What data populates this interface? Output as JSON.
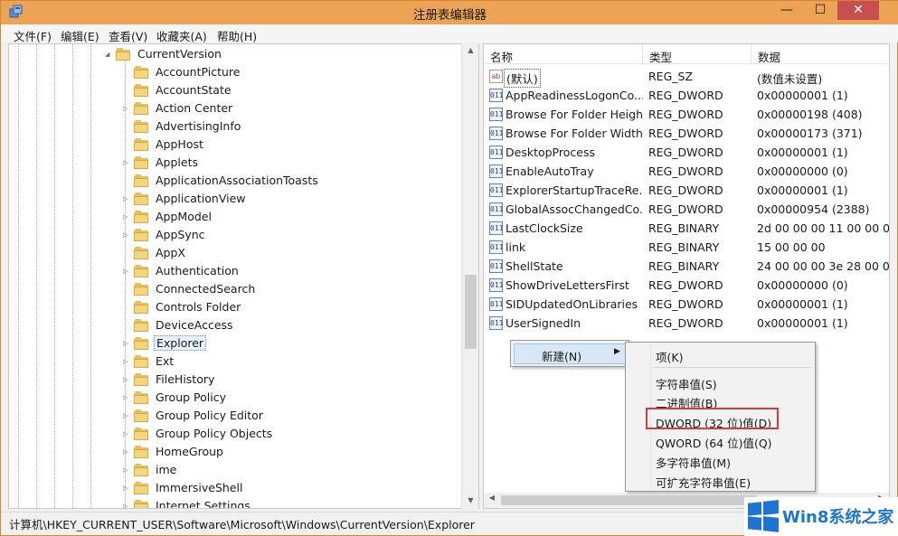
{
  "window": {
    "title": "注册表编辑器",
    "controls": {
      "minimize": "—",
      "maximize": "☐",
      "close": "✕"
    }
  },
  "menubar": [
    "文件(F)",
    "编辑(E)",
    "查看(V)",
    "收藏夹(A)",
    "帮助(H)"
  ],
  "tree": {
    "parent": "CurrentVersion",
    "items": [
      "AccountPicture",
      "AccountState",
      "Action Center",
      "AdvertisingInfo",
      "AppHost",
      "Applets",
      "ApplicationAssociationToasts",
      "ApplicationView",
      "AppModel",
      "AppSync",
      "AppX",
      "Authentication",
      "ConnectedSearch",
      "Controls Folder",
      "DeviceAccess",
      "Explorer",
      "Ext",
      "FileHistory",
      "Group Policy",
      "Group Policy Editor",
      "Group Policy Objects",
      "HomeGroup",
      "ime",
      "ImmersiveShell",
      "Internet Settings"
    ],
    "selected": "Explorer"
  },
  "list": {
    "columns": [
      "名称",
      "类型",
      "数据"
    ],
    "rows": [
      {
        "name": "(默认)",
        "type": "REG_SZ",
        "data": "(数值未设置)",
        "icon": "ab"
      },
      {
        "name": "AppReadinessLogonCo...",
        "type": "REG_DWORD",
        "data": "0x00000001 (1)",
        "icon": "011"
      },
      {
        "name": "Browse For Folder Height",
        "type": "REG_DWORD",
        "data": "0x00000198 (408)",
        "icon": "011"
      },
      {
        "name": "Browse For Folder Width",
        "type": "REG_DWORD",
        "data": "0x00000173 (371)",
        "icon": "011"
      },
      {
        "name": "DesktopProcess",
        "type": "REG_DWORD",
        "data": "0x00000001 (1)",
        "icon": "011"
      },
      {
        "name": "EnableAutoTray",
        "type": "REG_DWORD",
        "data": "0x00000000 (0)",
        "icon": "011"
      },
      {
        "name": "ExplorerStartupTraceRe...",
        "type": "REG_DWORD",
        "data": "0x00000001 (1)",
        "icon": "011"
      },
      {
        "name": "GlobalAssocChangedCo...",
        "type": "REG_DWORD",
        "data": "0x00000954 (2388)",
        "icon": "011"
      },
      {
        "name": "LastClockSize",
        "type": "REG_BINARY",
        "data": "2d 00 00 00 11 00 00 00 d",
        "icon": "011"
      },
      {
        "name": "link",
        "type": "REG_BINARY",
        "data": "15 00 00 00",
        "icon": "011"
      },
      {
        "name": "ShellState",
        "type": "REG_BINARY",
        "data": "24 00 00 00 3e 28 00 00 0",
        "icon": "011"
      },
      {
        "name": "ShowDriveLettersFirst",
        "type": "REG_DWORD",
        "data": "0x00000000 (0)",
        "icon": "011"
      },
      {
        "name": "SIDUpdatedOnLibraries",
        "type": "REG_DWORD",
        "data": "0x00000001 (1)",
        "icon": "011"
      },
      {
        "name": "UserSignedIn",
        "type": "REG_DWORD",
        "data": "0x00000001 (1)",
        "icon": "011"
      }
    ]
  },
  "context_menu": {
    "main_item": "新建(N)",
    "submenu": [
      "项(K)",
      "字符串值(S)",
      "二进制值(B)",
      "DWORD (32 位)值(D)",
      "QWORD (64 位)值(Q)",
      "多字符串值(M)",
      "可扩充字符串值(E)"
    ],
    "highlighted": "DWORD (32 位)值(D)"
  },
  "statusbar": {
    "path": "计算机\\HKEY_CURRENT_USER\\Software\\Microsoft\\Windows\\CurrentVersion\\Explorer"
  },
  "watermark": {
    "text": "Win8系统之家"
  },
  "colors": {
    "titlebar": "#eca356",
    "close_button": "#c7504f",
    "highlight_box": "#d43d3d",
    "watermark_blue": "#1e74d1"
  }
}
